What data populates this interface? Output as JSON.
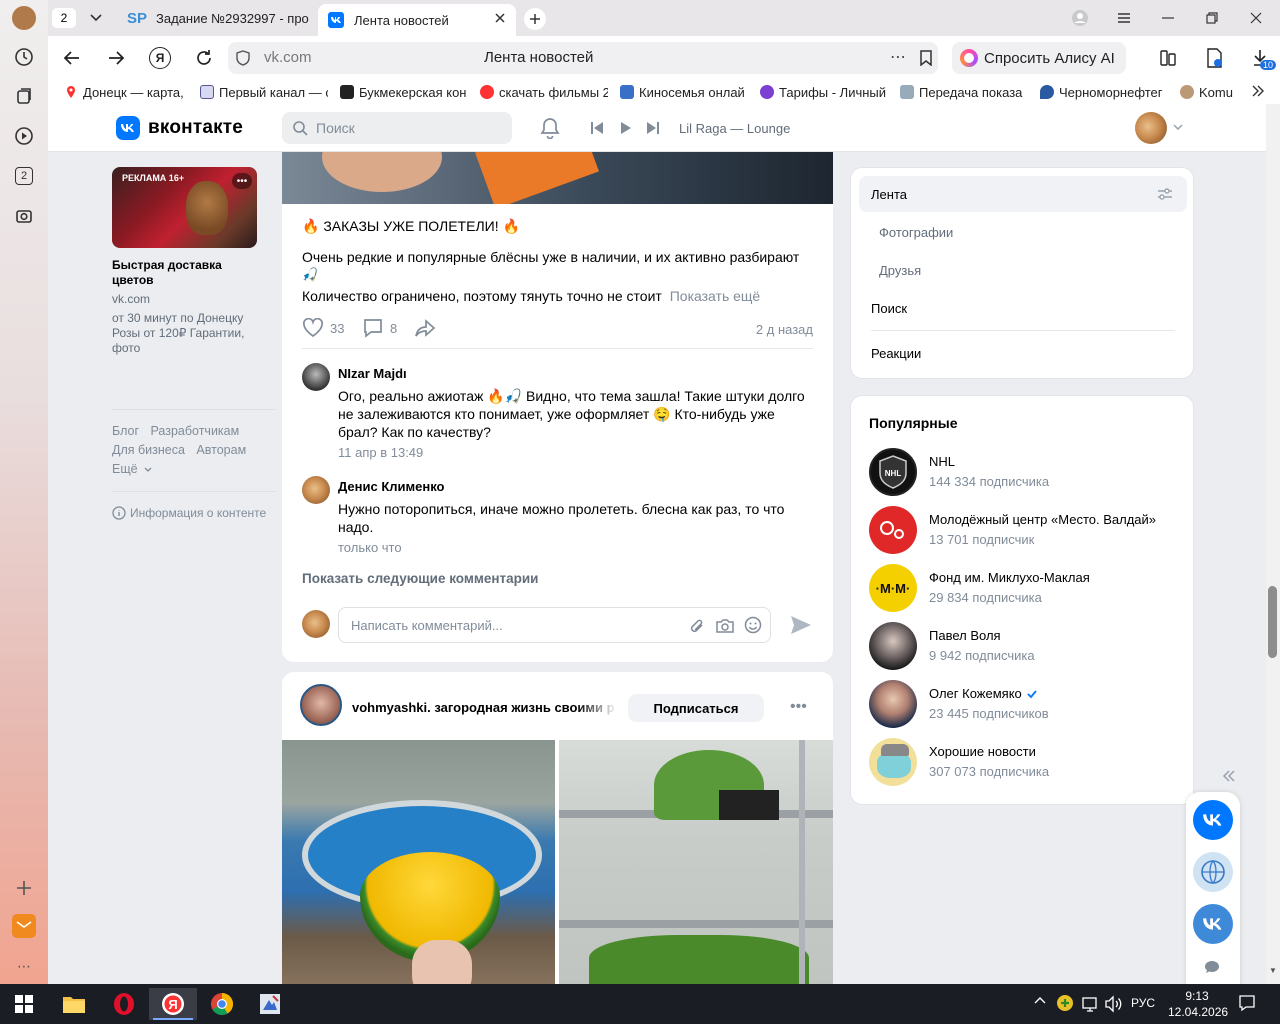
{
  "browser": {
    "tab_count": "2",
    "tabs": [
      {
        "label": "Задание №2932997 - про",
        "favicon": "SP"
      },
      {
        "label": "Лента новостей",
        "favicon": "VK"
      }
    ],
    "address": "vk.com",
    "page_title": "Лента новостей",
    "alice_label": "Спросить Алису AI",
    "downloads_badge": "10",
    "bookmarks": [
      "Донецк — карта, с",
      "Первый канал — с",
      "Букмекерская кон",
      "скачать фильмы 2",
      "Киносемья онлай",
      "Тарифы - Личный",
      "Передача показа",
      "Черноморнефтег",
      "Komu"
    ]
  },
  "vk": {
    "logo_text": "вконтакте",
    "search_placeholder": "Поиск",
    "player_track": "Lil Raga — Lounge"
  },
  "ad": {
    "badge": "РЕКЛАМА 16+",
    "title": "Быстрая доставка цветов",
    "domain": "vk.com",
    "description": "от 30 минут по Донецку Розы от 120₽ Гарантии, фото"
  },
  "left_links": {
    "row1": [
      "Блог",
      "Разработчикам"
    ],
    "row2": [
      "Для бизнеса",
      "Авторам"
    ],
    "more": "Ещё",
    "info": "Информация о контенте"
  },
  "post": {
    "headline": "🔥 ЗАКАЗЫ УЖЕ ПОЛЕТЕЛИ! 🔥",
    "text_line1": "Очень редкие и популярные блёсны уже в наличии, и их активно разбирают",
    "text_line2": "🎣",
    "text_line3": "Количество ограничено, поэтому тянуть точно не стоит",
    "show_more": "Показать ещё",
    "likes": "33",
    "comments": "8",
    "time": "2 д назад"
  },
  "comments": [
    {
      "name": "NIzar Majdı",
      "text": "Ого, реально ажиотаж 🔥🎣 Видно, что тема зашла! Такие штуки долго не залеживаются кто понимает, уже оформляет 🤤 Кто-нибудь уже брал? Как по качеству?",
      "time": "11 апр в 13:49"
    },
    {
      "name": "Денис Клименко",
      "text": "Нужно поторопиться, иначе можно пролететь. блесна как раз, то что надо.",
      "time": "только что"
    }
  ],
  "show_next_comments": "Показать следующие комментарии",
  "comment_placeholder": "Написать комментарий...",
  "post2": {
    "author": "vohmyashki. загородная жизнь своими р",
    "subscribe": "Подписаться"
  },
  "right_menu": {
    "items": [
      "Лента",
      "Фотографии",
      "Друзья",
      "Поиск",
      "Реакции"
    ]
  },
  "popular": {
    "title": "Популярные",
    "items": [
      {
        "name": "NHL",
        "subs": "144 334 подписчика"
      },
      {
        "name": "Молодёжный центр «Место. Валдай»",
        "subs": "13 701 подписчик"
      },
      {
        "name": "Фонд им. Миклухо-Маклая",
        "subs": "29 834 подписчика"
      },
      {
        "name": "Павел Воля",
        "subs": "9 942 подписчика"
      },
      {
        "name": "Олег Кожемяко",
        "subs": "23 445 подписчиков"
      },
      {
        "name": "Хорошие новости",
        "subs": "307 073 подписчика"
      }
    ]
  },
  "taskbar": {
    "lang": "РУС",
    "time": "9:13",
    "date": "12.04.2026"
  }
}
